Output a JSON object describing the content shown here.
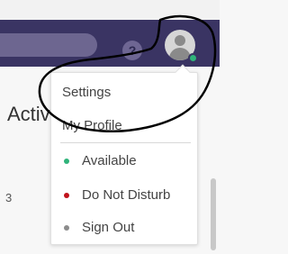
{
  "header": {
    "help_glyph": "?",
    "help_icon": "help-circle-icon",
    "avatar_icon": "user-avatar-icon",
    "presence_color": "#2fb37a",
    "background_color": "#3a3463"
  },
  "page": {
    "title_fragment": "Activ",
    "side_fragment": "3"
  },
  "menu": {
    "items": [
      {
        "label": "Settings"
      },
      {
        "label": "My Profile"
      }
    ],
    "statuses": [
      {
        "label": "Available",
        "color": "#2fb37a"
      },
      {
        "label": "Do Not Disturb",
        "color": "#c0131b"
      },
      {
        "label": "Sign Out",
        "color": "#8c8c8c"
      }
    ]
  }
}
